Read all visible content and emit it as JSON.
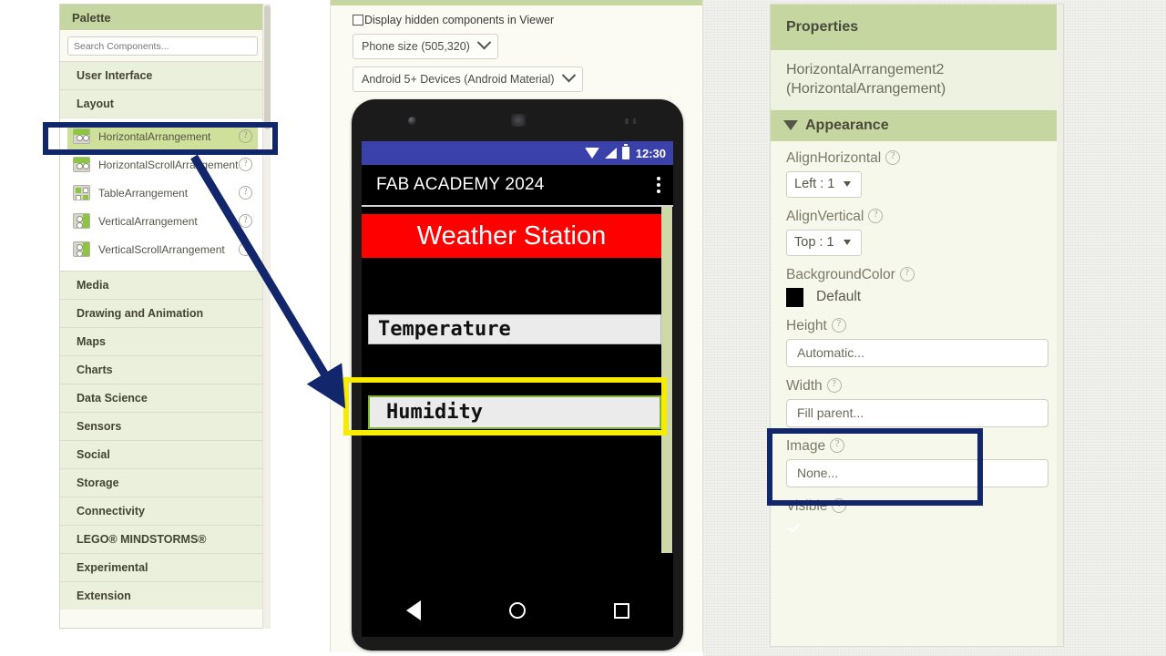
{
  "palette": {
    "title": "Palette",
    "search_placeholder": "Search Components...",
    "categories": [
      {
        "label": "User Interface",
        "open": false
      },
      {
        "label": "Layout",
        "open": true
      },
      {
        "label": "Media",
        "open": false
      },
      {
        "label": "Drawing and Animation",
        "open": false
      },
      {
        "label": "Maps",
        "open": false
      },
      {
        "label": "Charts",
        "open": false
      },
      {
        "label": "Data Science",
        "open": false
      },
      {
        "label": "Sensors",
        "open": false
      },
      {
        "label": "Social",
        "open": false
      },
      {
        "label": "Storage",
        "open": false
      },
      {
        "label": "Connectivity",
        "open": false
      },
      {
        "label": "LEGO® MINDSTORMS®",
        "open": false
      },
      {
        "label": "Experimental",
        "open": false
      },
      {
        "label": "Extension",
        "open": false
      }
    ],
    "layout_components": [
      {
        "label": "HorizontalArrangement",
        "icon": "horizontal-arrangement-icon",
        "selected": true,
        "help": "?"
      },
      {
        "label": "HorizontalScrollArrangement",
        "icon": "horizontal-scroll-arrangement-icon",
        "selected": false,
        "help": "?"
      },
      {
        "label": "TableArrangement",
        "icon": "table-arrangement-icon",
        "selected": false,
        "help": "?"
      },
      {
        "label": "VerticalArrangement",
        "icon": "vertical-arrangement-icon",
        "selected": false,
        "help": "?"
      },
      {
        "label": "VerticalScrollArrangement",
        "icon": "vertical-scroll-arrangement-icon",
        "selected": false,
        "help": "?"
      }
    ]
  },
  "viewer": {
    "hidden_components_label": "Display hidden components in Viewer",
    "hidden_components_checked": false,
    "phone_size_value": "Phone size (505,320)",
    "device_theme_value": "Android 5+ Devices (Android Material)",
    "phone": {
      "status_time": "12:30",
      "app_title": "FAB ACADEMY 2024",
      "menu_icon": "kebab-menu-icon",
      "banner_text": "Weather Station",
      "banner_bg": "#ff0000",
      "banner_fg": "#ffffff",
      "label_temperature": "Temperature",
      "label_humidity": "Humidity",
      "nav_back": "back-icon",
      "nav_home": "home-icon",
      "nav_recent": "recents-icon",
      "statusbar_color": "#3b41ab"
    }
  },
  "properties": {
    "title": "Properties",
    "component_name": "HorizontalArrangement2\n(HorizontalArrangement)",
    "section": "Appearance",
    "fields": {
      "align_horizontal_label": "AlignHorizontal",
      "align_horizontal_value": "Left : 1",
      "align_vertical_label": "AlignVertical",
      "align_vertical_value": "Top : 1",
      "background_color_label": "BackgroundColor",
      "background_color_value": "Default",
      "background_color_swatch": "#000000",
      "height_label": "Height",
      "height_value": "Automatic...",
      "width_label": "Width",
      "width_value": "Fill parent...",
      "image_label": "Image",
      "image_value": "None...",
      "visible_label": "Visible",
      "visible_checked": true
    },
    "help_glyph": "?"
  },
  "annotations": {
    "highlight_color_navy": "#11266b",
    "highlight_color_yellow": "#f5ec00",
    "arrow_name": "annotation-arrow"
  }
}
